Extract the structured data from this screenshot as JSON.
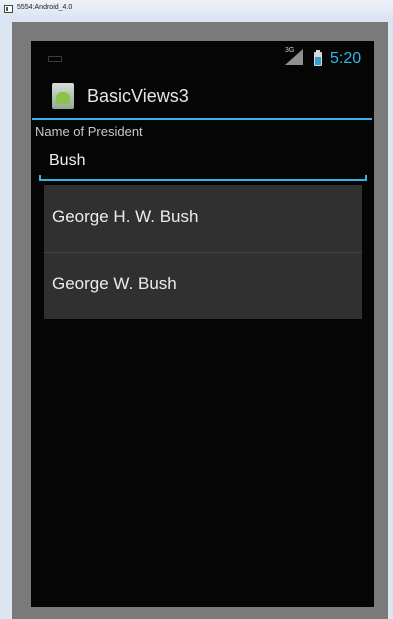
{
  "window": {
    "title": "5554:Android_4.0"
  },
  "statusbar": {
    "network_label": "3G",
    "time": "5:20",
    "accent": "#33b5e5"
  },
  "actionbar": {
    "title": "BasicViews3",
    "icon": "android-app-icon"
  },
  "form": {
    "label": "Name of President",
    "input_value": "Bush"
  },
  "suggestions": [
    "George H. W. Bush",
    "George W. Bush"
  ]
}
